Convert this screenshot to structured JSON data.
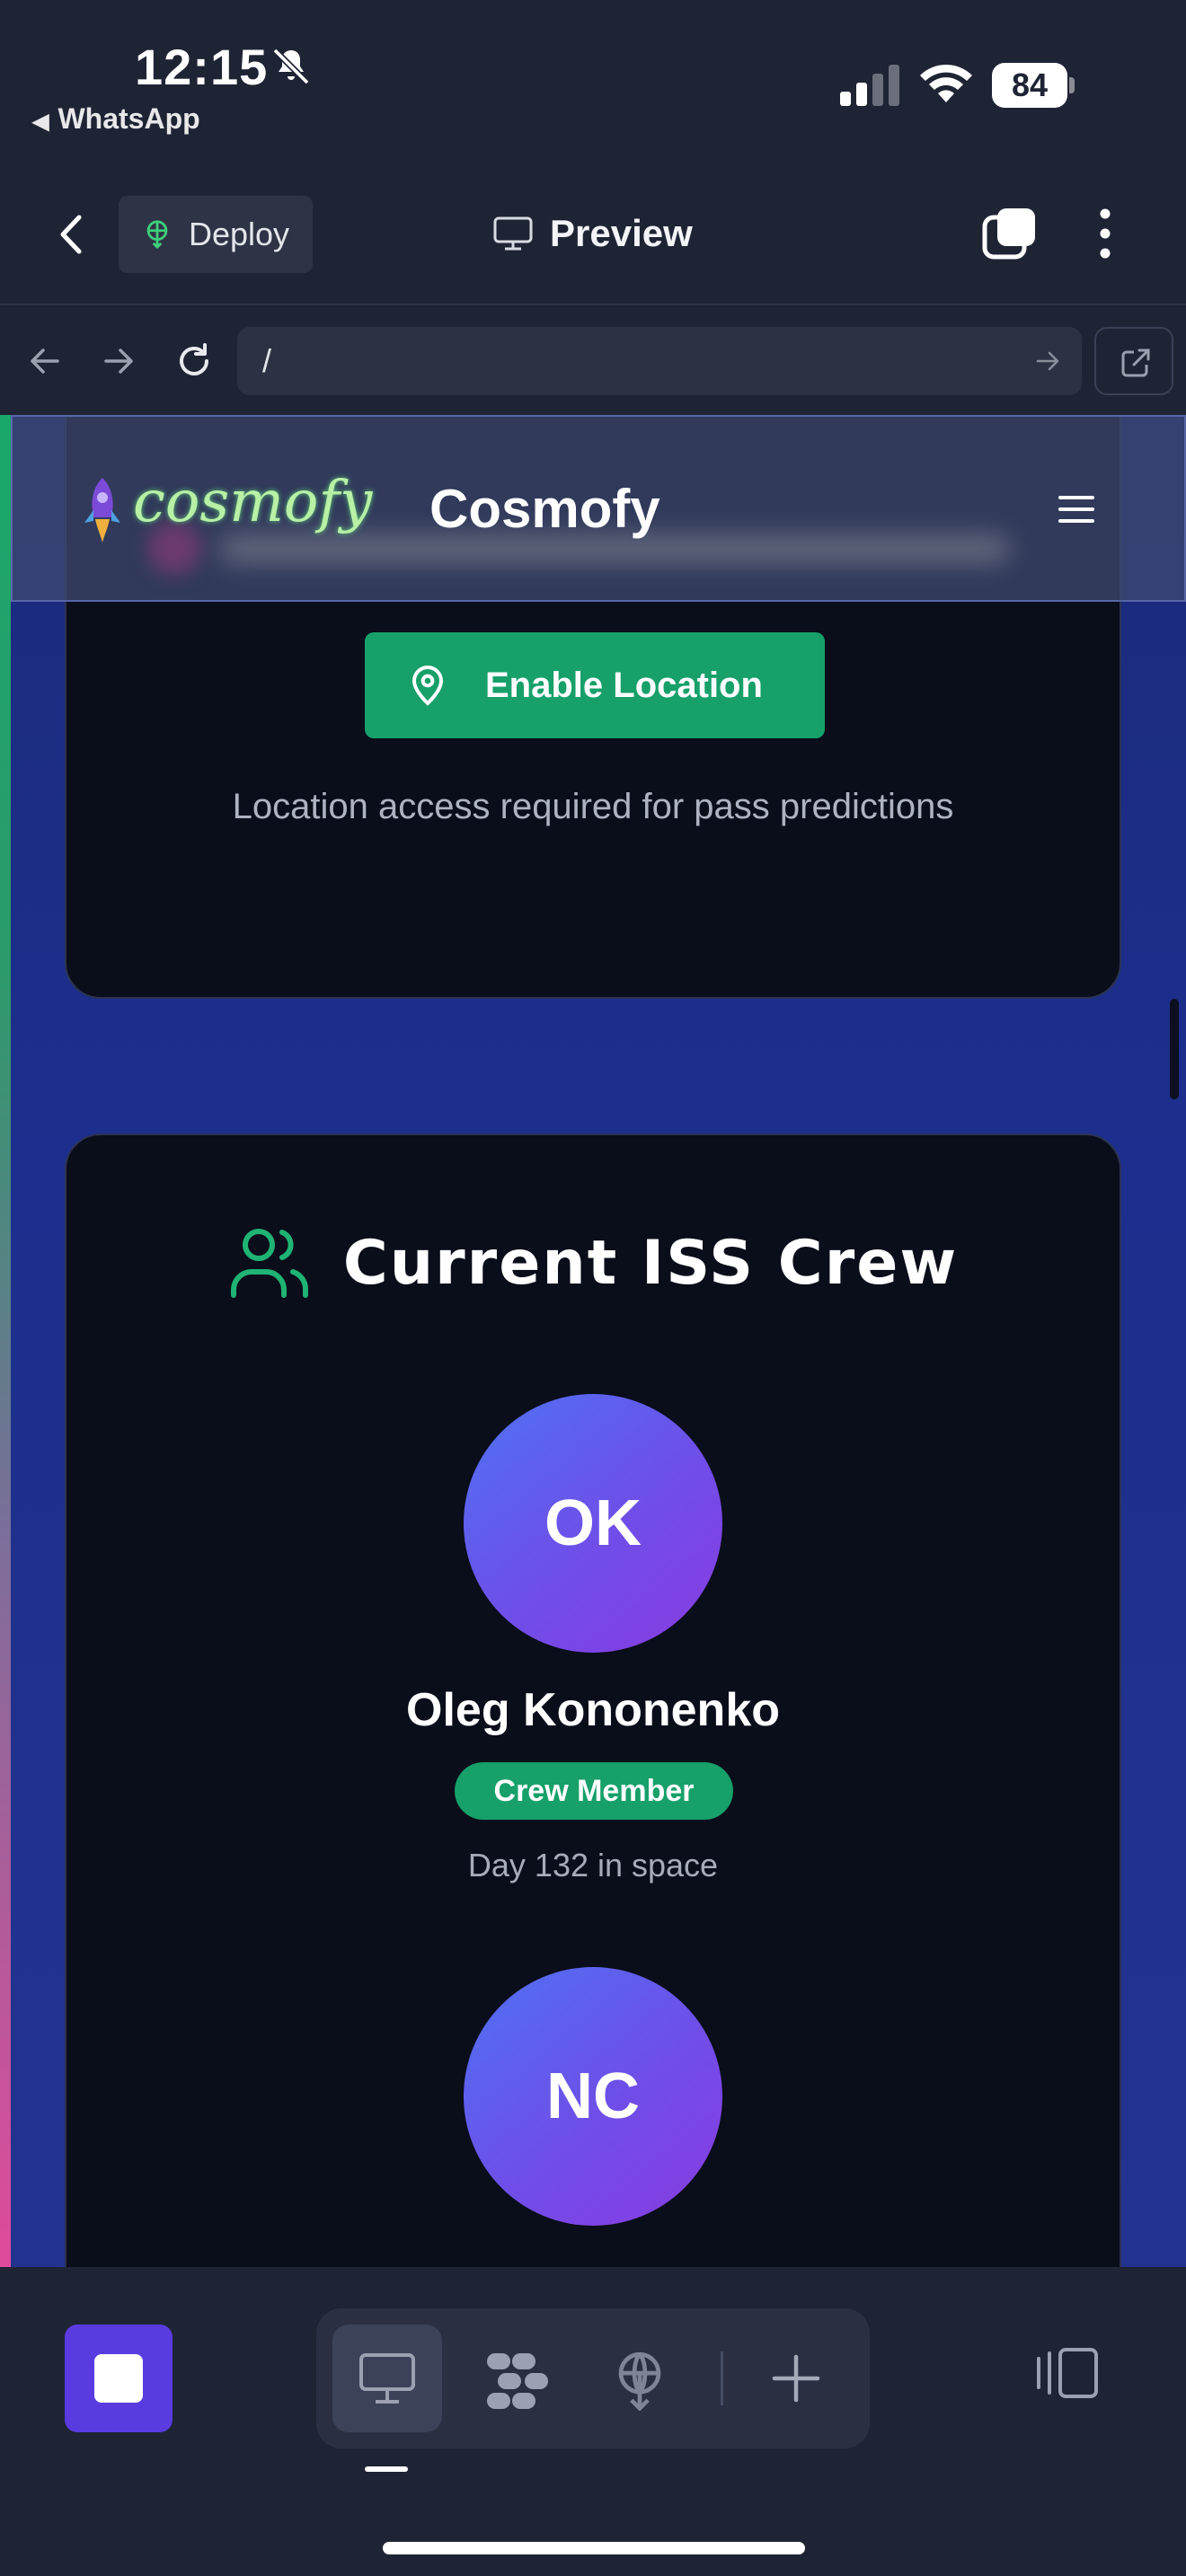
{
  "status_bar": {
    "time": "12:15",
    "back_app": "WhatsApp",
    "battery": "84",
    "icons": [
      "bell-slash-icon",
      "signal-icon",
      "wifi-icon",
      "battery-icon"
    ]
  },
  "app_header": {
    "deploy_label": "Deploy",
    "preview_label": "Preview"
  },
  "browser": {
    "url": "/"
  },
  "site": {
    "logo_text": "cosmofy",
    "title": "Cosmofy"
  },
  "location_card": {
    "button_label": "Enable Location",
    "note": "Location access required for pass predictions"
  },
  "crew_card": {
    "title": "Current ISS Crew",
    "members": [
      {
        "initials": "OK",
        "name": "Oleg Kononenko",
        "role": "Crew Member",
        "days": "Day 132 in space"
      },
      {
        "initials": "NC"
      }
    ]
  },
  "colors": {
    "accent_green": "#17a06a",
    "stop_purple": "#5a3be0",
    "avatar_gradient_start": "#4e72f2",
    "avatar_gradient_end": "#8a3ae0",
    "page_blue": "#1d2f8e"
  }
}
